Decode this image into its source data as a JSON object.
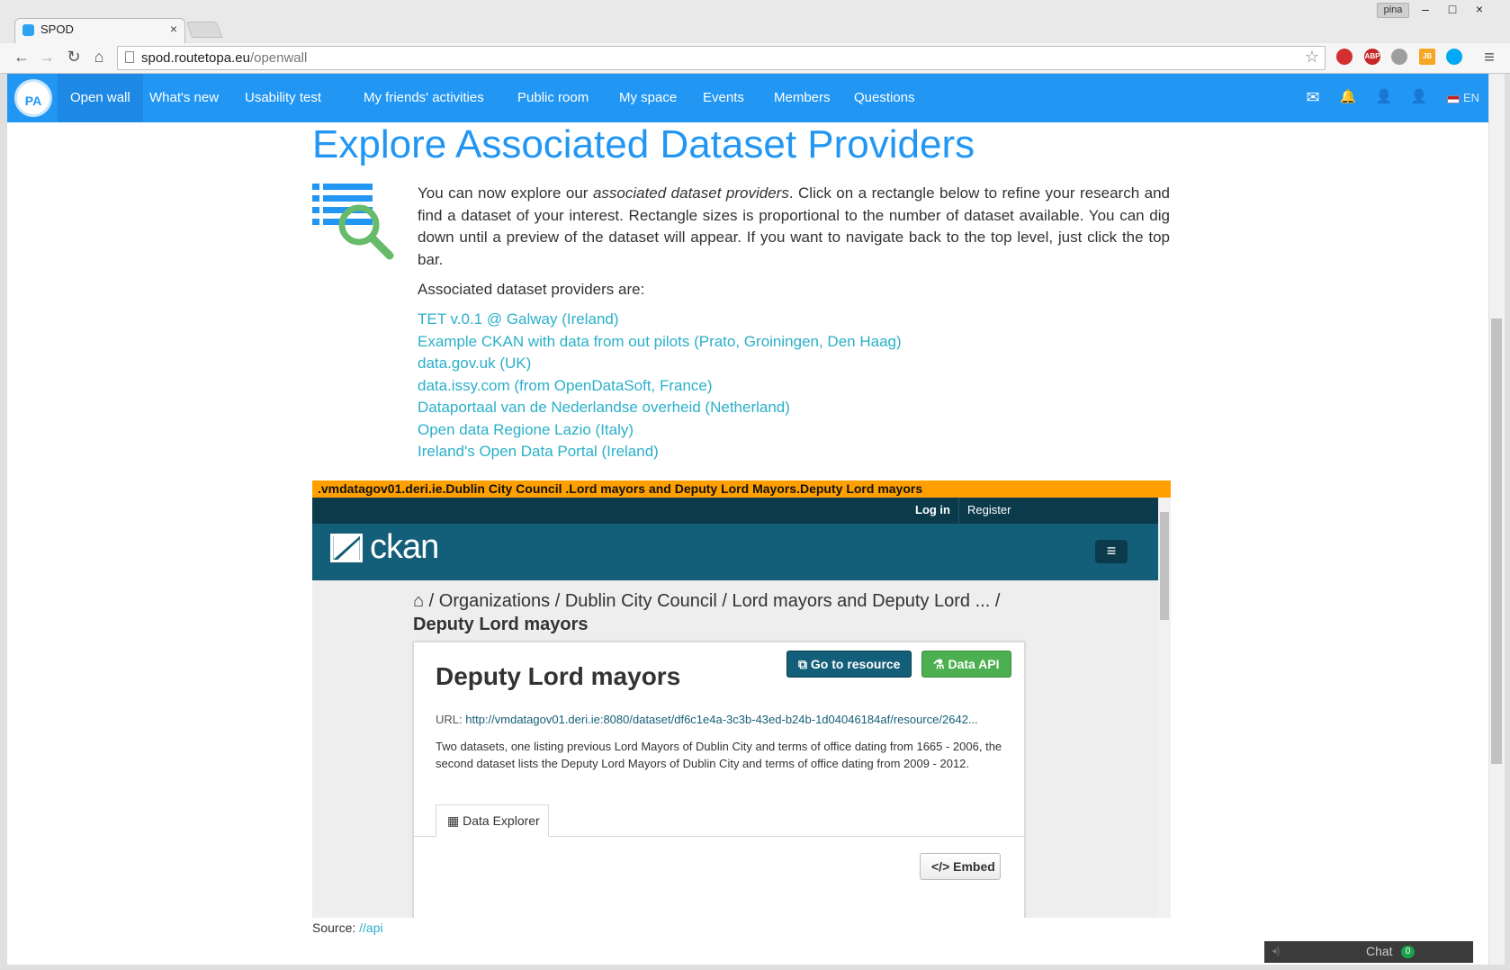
{
  "browser": {
    "tab_title": "SPOD",
    "tab_close": "×",
    "user_badge": "pina",
    "window_buttons": {
      "minimize": "–",
      "maximize": "□",
      "close": "×"
    },
    "url_host": "spod.routetopa.eu",
    "url_path": "/openwall",
    "nav_icons": {
      "back": "←",
      "forward": "→",
      "reload": "↻",
      "home": "⌂",
      "star": "☆",
      "menu": "≡"
    },
    "extensions": [
      "stop-ext",
      "ABP",
      "ghost-ext",
      "JB",
      "skype-ext"
    ]
  },
  "nav": {
    "logo": "PA",
    "items": [
      "Open wall",
      "What's new",
      "Usability test",
      "My friends' activities",
      "Public room",
      "My space",
      "Events",
      "Members",
      "Questions"
    ],
    "active": "Open wall",
    "right_icons": {
      "mail": "✉",
      "bell": "🔔",
      "user1": "👤",
      "user2": "👤"
    },
    "lang": "EN"
  },
  "main": {
    "heading": "Explore Associated Dataset Providers",
    "intro_1": "You can now explore our ",
    "intro_em": "associated dataset providers",
    "intro_2": ". Click on a rectangle below to refine your research and find a dataset of your interest. Rectangle sizes is proportional to the number of dataset available. You can dig down until a preview of the dataset will appear. If you want to navigate back to the top level, just click the top bar.",
    "providers_label": "Associated dataset providers are:",
    "providers": [
      "TET v.0.1 @ Galway (Ireland)",
      "Example CKAN with data from out pilots (Prato, Groiningen, Den Haag)",
      "data.gov.uk (UK)",
      "data.issy.com (from OpenDataSoft, France)",
      "Dataportaal van de Nederlandse overheid (Netherland)",
      "Open data Regione Lazio (Italy)",
      "Ireland's Open Data Portal (Ireland)"
    ],
    "dataset_bar": ".vmdatagov01.deri.ie.Dublin City Council .Lord mayors and Deputy Lord Mayors.Deputy Lord mayors",
    "source_label": "Source:",
    "source_link": "//api"
  },
  "ckan": {
    "login": "Log in",
    "register": "Register",
    "logo_text": "ckan",
    "menu_icon": "≡",
    "breadcrumb_home_icon": "⌂",
    "breadcrumb": " / Organizations / Dublin City Council / Lord mayors and Deputy Lord ... / ",
    "breadcrumb_last": "Deputy Lord mayors",
    "resource_title": "Deputy Lord mayors",
    "go_button": "Go to resource",
    "api_button": "Data API",
    "url_label": "URL:",
    "url": "http://vmdatagov01.deri.ie:8080/dataset/df6c1e4a-3c3b-43ed-b24b-1d04046184af/resource/2642...",
    "description": "Two datasets, one listing previous Lord Mayors of Dublin City and terms of office dating from 1665 - 2006, the second dataset lists the Deputy Lord Mayors of Dublin City and terms of office dating from 2009 - 2012.",
    "tab_label": "Data Explorer",
    "embed_button": "Embed"
  },
  "chat": {
    "label": "Chat",
    "count": "0"
  }
}
